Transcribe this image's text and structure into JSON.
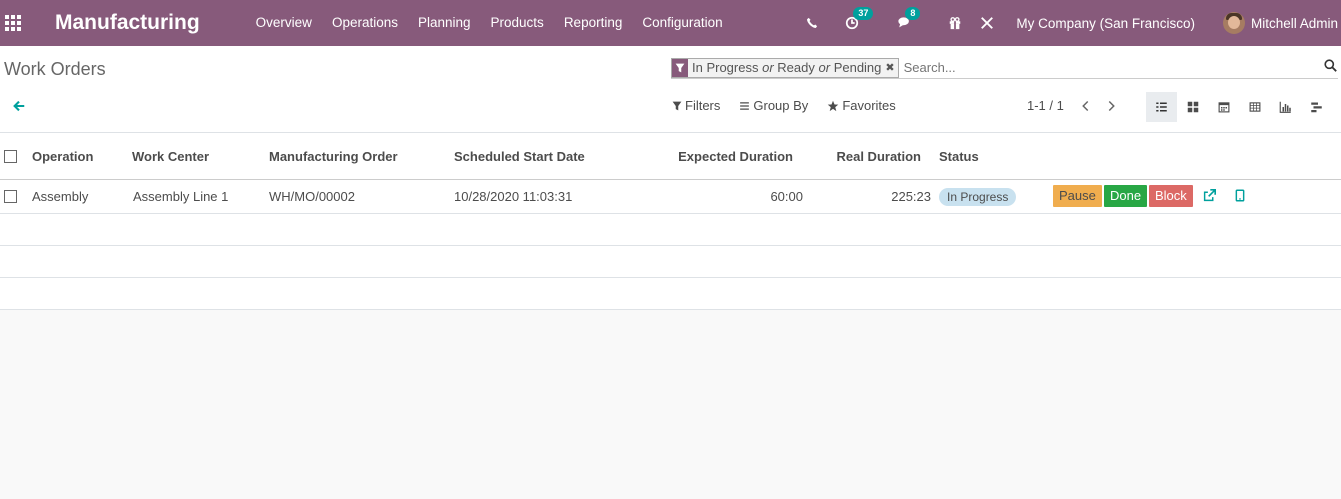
{
  "navbar": {
    "app_name": "Manufacturing",
    "menu": [
      "Overview",
      "Operations",
      "Planning",
      "Products",
      "Reporting",
      "Configuration"
    ],
    "activity_count": "37",
    "messages_count": "8",
    "company": "My Company (San Francisco)",
    "user": "Mitchell Admin",
    "bg_color": "#875a7b"
  },
  "control_panel": {
    "breadcrumb": "Work Orders",
    "search": {
      "facet_values": [
        "In Progress",
        "Ready",
        "Pending"
      ],
      "facet_separator": "or",
      "placeholder": "Search..."
    },
    "filters_label": "Filters",
    "group_by_label": "Group By",
    "favorites_label": "Favorites",
    "pager": "1-1 / 1",
    "views": [
      "list-view-icon",
      "kanban-view-icon",
      "calendar-view-icon",
      "pivot-view-icon",
      "graph-view-icon",
      "gantt-view-icon"
    ],
    "active_view": "list-view-icon"
  },
  "table": {
    "columns": [
      "Operation",
      "Work Center",
      "Manufacturing Order",
      "Scheduled Start Date",
      "Expected Duration",
      "Real Duration",
      "Status"
    ],
    "rows": [
      {
        "operation": "Assembly",
        "work_center": "Assembly Line 1",
        "manufacturing_order": "WH/MO/00002",
        "scheduled_start_date": "10/28/2020 11:03:31",
        "expected_duration": "60:00",
        "real_duration": "225:23",
        "status": "In Progress",
        "actions": [
          "Pause",
          "Done",
          "Block"
        ]
      }
    ]
  },
  "colors": {
    "accent": "#00a09d",
    "pause": "#f0ad4e",
    "done": "#28a745",
    "block": "#dc6965",
    "status_badge": "#c8e1ef"
  }
}
